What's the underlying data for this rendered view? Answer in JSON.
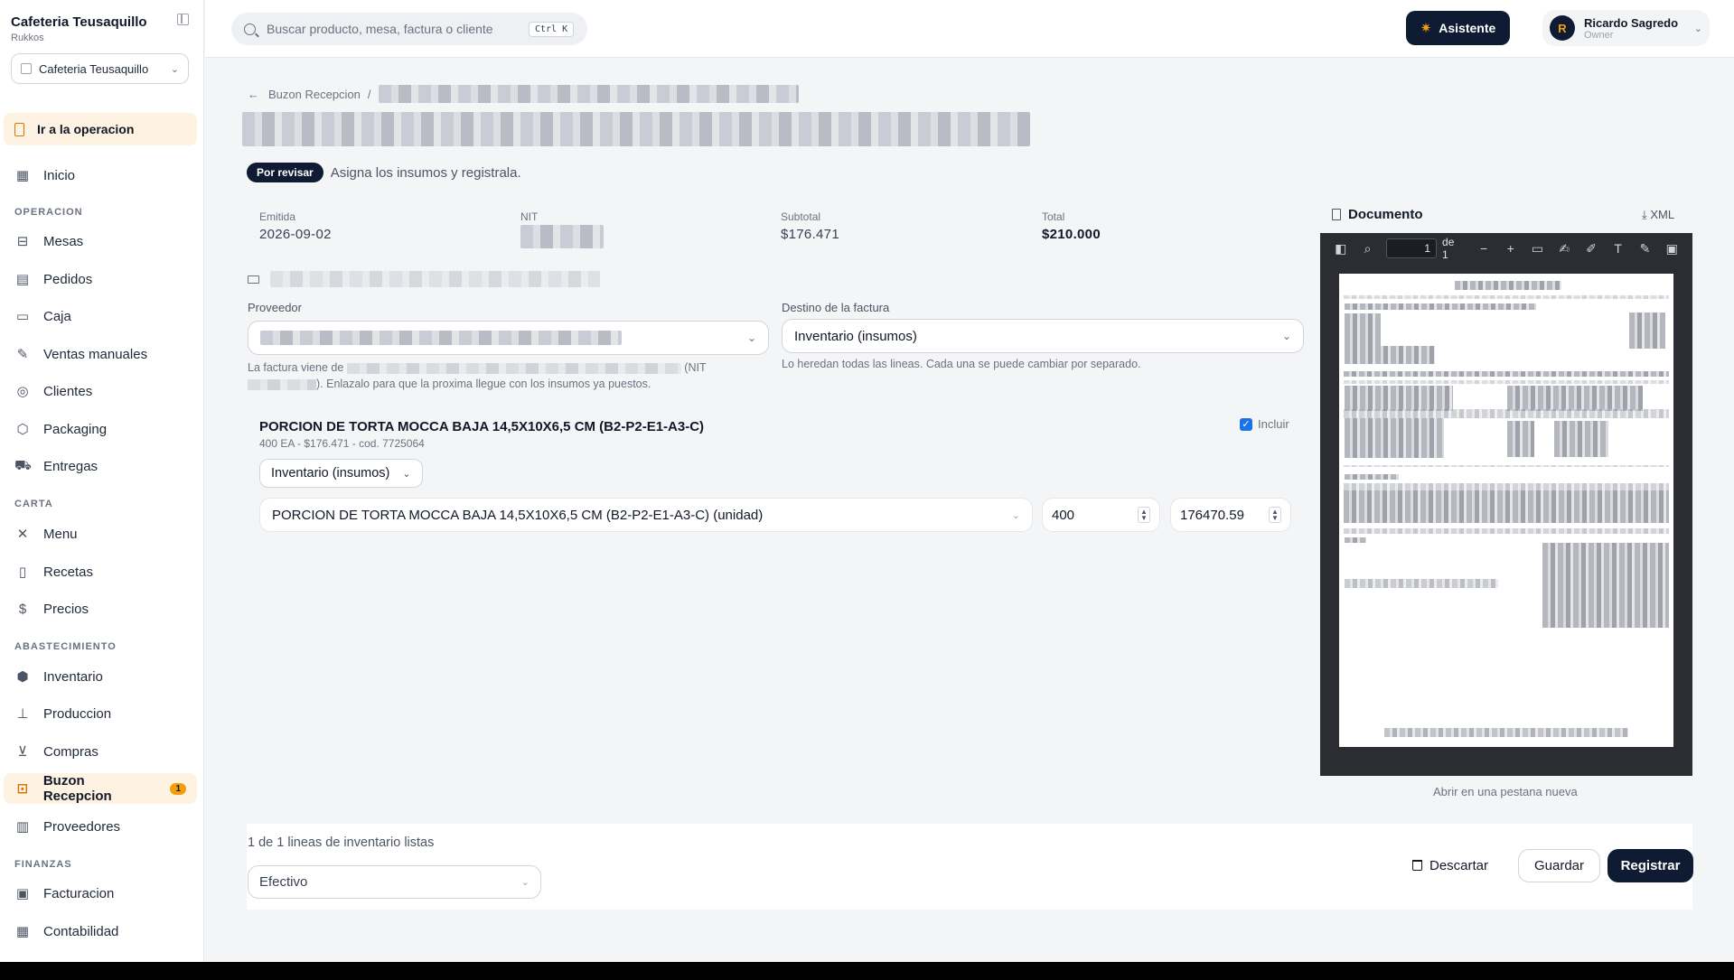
{
  "sidebar": {
    "brand_name": "Cafeteria Teusaquillo",
    "brand_sub": "Rukkos",
    "org_select": "Cafeteria Teusaquillo",
    "goto_operation": "Ir a la operacion",
    "home": "Inicio",
    "sections": {
      "operacion": "OPERACION",
      "carta": "CARTA",
      "abastecimiento": "ABASTECIMIENTO",
      "finanzas": "FINANZAS"
    },
    "items": {
      "mesas": "Mesas",
      "pedidos": "Pedidos",
      "caja": "Caja",
      "ventas_manuales": "Ventas manuales",
      "clientes": "Clientes",
      "packaging": "Packaging",
      "entregas": "Entregas",
      "menu": "Menu",
      "recetas": "Recetas",
      "precios": "Precios",
      "inventario": "Inventario",
      "produccion": "Produccion",
      "compras": "Compras",
      "buzon": "Buzon Recepcion",
      "buzon_badge": "1",
      "proveedores": "Proveedores",
      "facturacion": "Facturacion",
      "contabilidad": "Contabilidad"
    }
  },
  "topbar": {
    "search_placeholder": "Buscar producto, mesa, factura o cliente",
    "search_shortcut": "Ctrl K",
    "assistant_label": "Asistente",
    "user_initial": "R",
    "user_name": "Ricardo Sagredo",
    "user_role": "Owner"
  },
  "page": {
    "breadcrumb_parent": "Buzon Recepcion",
    "status_badge": "Por revisar",
    "status_desc": "Asigna los insumos y registrala.",
    "emitida_label": "Emitida",
    "emitida_value": "2026-09-02",
    "nit_label": "NIT",
    "subtotal_label": "Subtotal",
    "subtotal_value": "$176.471",
    "total_label": "Total",
    "total_value": "$210.000",
    "proveedor_label": "Proveedor",
    "destino_label": "Destino de la factura",
    "destino_value": "Inventario (insumos)",
    "proveedor_help_1": "La factura viene de",
    "proveedor_help_2": "(NIT",
    "proveedor_help_3": "). Enlazalo para que la proxima llegue con los insumos ya puestos.",
    "destino_help": "Lo heredan todas las lineas. Cada una se puede cambiar por separado."
  },
  "item": {
    "title": "PORCION DE TORTA MOCCA BAJA 14,5X10X6,5 CM (B2-P2-E1-A3-C)",
    "subtitle": "400 EA - $176.471 - cod. 7725064",
    "include_label": "Incluir",
    "destination": "Inventario (insumos)",
    "product_match": "PORCION DE TORTA MOCCA BAJA 14,5X10X6,5 CM (B2-P2-E1-A3-C) (unidad)",
    "quantity": "400",
    "cost": "176470.59"
  },
  "document": {
    "title": "Documento",
    "xml_label": "XML",
    "page_current": "1",
    "page_of": "de 1",
    "open_new_tab": "Abrir en una pestana nueva"
  },
  "footer": {
    "lines_ready": "1 de 1 lineas de inventario listas",
    "payment_method": "Efectivo",
    "discard": "Descartar",
    "save": "Guardar",
    "register": "Registrar"
  },
  "icons": {
    "sidebar_toggle": "sidebar-toggle-icon",
    "store": "store-icon",
    "search": "search-icon",
    "sparkle": "sparkle-icon",
    "mail": "mail-icon",
    "file": "file-icon",
    "download": "download-icon",
    "trash": "trash-icon"
  },
  "colors": {
    "navy": "#0f1b33",
    "accent": "#f59e0b",
    "active_bg": "#fef3e2",
    "checkbox": "#1a73e8"
  }
}
